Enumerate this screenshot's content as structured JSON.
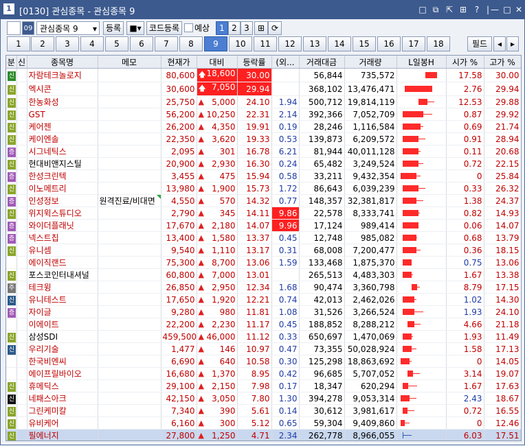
{
  "window": {
    "title": "[0130] 관심종목 - 관심종목 9",
    "app_icon": "1",
    "buttons": [
      "□",
      "⧉",
      "⇱",
      "⊞",
      "?",
      "|",
      "—",
      "□",
      "✕"
    ]
  },
  "toolbar": {
    "group_select": "관심종목 9",
    "register": "등록",
    "code_register": "코드등록",
    "reserve": "예상",
    "pages": [
      "1",
      "2",
      "3"
    ]
  },
  "tabs": [
    "1",
    "2",
    "3",
    "4",
    "5",
    "6",
    "7",
    "8",
    "9",
    "10",
    "11",
    "12",
    "13",
    "14",
    "15",
    "16",
    "17",
    "18"
  ],
  "selected_tab": "9",
  "field_button": "필드",
  "headers": [
    "분",
    "신",
    "종목명",
    "메모",
    "현재가",
    "대비",
    "등락률",
    "(외...",
    "거래대금",
    "거래량",
    "L일봉H",
    "시가 %",
    "고가 %"
  ],
  "rows": [
    {
      "badge": "신",
      "badge_color": "#2b8a2b",
      "name": "자람테크놀로지",
      "memo": "",
      "price": "80,600",
      "diff": "18,600",
      "rate": "30.00",
      "foreign": "",
      "amount": "56,844",
      "volume": "735,572",
      "open": "17.58",
      "high": "30.00",
      "up_arrow": true,
      "hi_diff": true,
      "hi_rate": true,
      "spark": {
        "x": 0.6,
        "w": 0.25,
        "wick": 0
      }
    },
    {
      "badge": "신",
      "badge_color": "#8aa52b",
      "name": "엑시콘",
      "memo": "",
      "price": "30,600",
      "diff": "7,050",
      "rate": "29.94",
      "foreign": "",
      "amount": "368,102",
      "volume": "13,476,471",
      "open": "2.76",
      "high": "29.94",
      "up_arrow": true,
      "hi_diff": true,
      "hi_rate": true,
      "spark": {
        "x": 0.15,
        "w": 0.6,
        "wick": 0
      }
    },
    {
      "badge": "신",
      "badge_color": "#8aa52b",
      "name": "한농화성",
      "memo": "",
      "price": "25,750",
      "diff": "5,000",
      "rate": "24.10",
      "foreign": "1.94",
      "amount": "500,712",
      "volume": "19,814,119",
      "open": "12.53",
      "high": "29.88",
      "spark": {
        "x": 0.45,
        "w": 0.2,
        "wick": 0.15
      }
    },
    {
      "badge": "신",
      "badge_color": "#8aa52b",
      "name": "GST",
      "memo": "",
      "price": "56,200",
      "diff": "10,250",
      "rate": "22.31",
      "foreign": "2.14",
      "amount": "392,366",
      "volume": "7,052,709",
      "open": "0.87",
      "high": "29.92",
      "spark": {
        "x": 0.1,
        "w": 0.45,
        "wick": 0.2
      }
    },
    {
      "badge": "신",
      "badge_color": "#8aa52b",
      "name": "케어젠",
      "memo": "",
      "price": "26,200",
      "diff": "4,350",
      "rate": "19.91",
      "foreign": "0.19",
      "amount": "28,246",
      "volume": "1,116,584",
      "open": "0.69",
      "high": "21.74",
      "spark": {
        "x": 0.1,
        "w": 0.4,
        "wick": 0.05
      }
    },
    {
      "badge": "신",
      "badge_color": "#8aa52b",
      "name": "케이엔솔",
      "memo": "",
      "price": "22,350",
      "diff": "3,620",
      "rate": "19.33",
      "foreign": "0.53",
      "amount": "139,873",
      "volume": "6,209,572",
      "open": "0.91",
      "high": "28.94",
      "spark": {
        "x": 0.1,
        "w": 0.35,
        "wick": 0.15
      }
    },
    {
      "badge": "증",
      "badge_color": "#a05ab5",
      "name": "시그네틱스",
      "memo": "",
      "price": "2,095",
      "diff": "301",
      "rate": "16.78",
      "foreign": "6.21",
      "amount": "81,944",
      "volume": "40,011,128",
      "open": "0.11",
      "high": "20.68",
      "spark": {
        "x": 0.1,
        "w": 0.35,
        "wick": 0.05
      }
    },
    {
      "badge": "신",
      "badge_color": "#8aa52b",
      "name": "현대비앤지스틸",
      "memo": "",
      "price": "20,900",
      "diff": "2,930",
      "rate": "16.30",
      "foreign": "0.24",
      "amount": "65,482",
      "volume": "3,249,524",
      "open": "0.72",
      "high": "22.15",
      "blk": true,
      "spark": {
        "x": 0.1,
        "w": 0.35,
        "wick": 0.1
      }
    },
    {
      "badge": "증",
      "badge_color": "#a05ab5",
      "name": "한성크린텍",
      "memo": "",
      "price": "3,455",
      "diff": "475",
      "rate": "15.94",
      "foreign": "0.58",
      "amount": "33,211",
      "volume": "9,432,354",
      "open": "0",
      "high": "25.84",
      "spark": {
        "x": 0.05,
        "w": 0.35,
        "wick": 0.1
      }
    },
    {
      "badge": "신",
      "badge_color": "#8aa52b",
      "name": "이노메트리",
      "memo": "",
      "price": "13,980",
      "diff": "1,900",
      "rate": "15.73",
      "foreign": "1.72",
      "amount": "86,643",
      "volume": "6,039,239",
      "open": "0.33",
      "high": "26.32",
      "spark": {
        "x": 0.1,
        "w": 0.35,
        "wick": 0.15
      }
    },
    {
      "badge": "증",
      "badge_color": "#a05ab5",
      "name": "인성정보",
      "memo": "원격진료/비대면",
      "price": "4,550",
      "diff": "570",
      "rate": "14.32",
      "foreign": "0.77",
      "amount": "148,357",
      "volume": "32,381,817",
      "open": "1.38",
      "high": "24.37",
      "spark": {
        "x": 0.1,
        "w": 0.3,
        "wick": 0.15
      }
    },
    {
      "badge": "신",
      "badge_color": "#8aa52b",
      "name": "위지윅스튜디오",
      "memo": "",
      "price": "2,790",
      "diff": "345",
      "rate": "14.11",
      "foreign": "9.86",
      "amount": "22,578",
      "volume": "8,333,741",
      "open": "0.82",
      "high": "14.93",
      "hi_foreign": true,
      "spark": {
        "x": 0.1,
        "w": 0.35,
        "wick": 0.02
      }
    },
    {
      "badge": "증",
      "badge_color": "#a05ab5",
      "name": "와이더플래닛",
      "memo": "",
      "price": "17,670",
      "diff": "2,180",
      "rate": "14.07",
      "foreign": "9.96",
      "amount": "17,124",
      "volume": "989,414",
      "open": "0.06",
      "high": "14.07",
      "hi_foreign": true,
      "spark": {
        "x": 0.1,
        "w": 0.35,
        "wick": 0
      }
    },
    {
      "badge": "증",
      "badge_color": "#a05ab5",
      "name": "넥스트칩",
      "memo": "",
      "price": "13,400",
      "diff": "1,580",
      "rate": "13.37",
      "foreign": "0.45",
      "amount": "12,748",
      "volume": "985,082",
      "open": "0.68",
      "high": "13.79",
      "spark": {
        "x": 0.1,
        "w": 0.3,
        "wick": 0.02
      }
    },
    {
      "badge": "신",
      "badge_color": "#8aa52b",
      "name": "유니셈",
      "memo": "",
      "price": "9,540",
      "diff": "1,110",
      "rate": "13.17",
      "foreign": "0.31",
      "amount": "68,008",
      "volume": "7,200,477",
      "open": "0.36",
      "high": "18.15",
      "spark": {
        "x": 0.1,
        "w": 0.3,
        "wick": 0.1
      }
    },
    {
      "badge": "",
      "badge_color": "",
      "name": "에이직랜드",
      "memo": "",
      "price": "75,300",
      "diff": "8,700",
      "rate": "13.06",
      "foreign": "1.59",
      "amount": "133,468",
      "volume": "1,875,370",
      "open": "0.75",
      "high": "13.06",
      "open_blue": true,
      "spark": {
        "x": 0.1,
        "w": 0.2,
        "wick": 0
      }
    },
    {
      "badge": "신",
      "badge_color": "#8aa52b",
      "name": "포스코인터내셔널",
      "memo": "",
      "price": "60,800",
      "diff": "7,000",
      "rate": "13.01",
      "foreign": "",
      "amount": "265,513",
      "volume": "4,483,303",
      "open": "1.67",
      "high": "13.38",
      "blk": true,
      "spark": {
        "x": 0.1,
        "w": 0.2,
        "wick": 0.02
      }
    },
    {
      "badge": "주",
      "badge_color": "#777777",
      "name": "테크윙",
      "memo": "",
      "price": "26,850",
      "diff": "2,950",
      "rate": "12.34",
      "foreign": "1.68",
      "amount": "90,474",
      "volume": "3,360,798",
      "open": "8.79",
      "high": "17.15",
      "spark": {
        "x": 0.3,
        "w": 0.12,
        "wick": 0.05
      }
    },
    {
      "badge": "신",
      "badge_color": "#2b5a8a",
      "name": "유니테스트",
      "memo": "",
      "price": "17,650",
      "diff": "1,920",
      "rate": "12.21",
      "foreign": "0.74",
      "amount": "42,013",
      "volume": "2,462,026",
      "open": "1.02",
      "high": "14.30",
      "open_blue": true,
      "spark": {
        "x": 0.1,
        "w": 0.25,
        "wick": 0.05
      }
    },
    {
      "badge": "증",
      "badge_color": "#a05ab5",
      "name": "자이글",
      "memo": "",
      "price": "9,280",
      "diff": "980",
      "rate": "11.81",
      "foreign": "1.08",
      "amount": "31,526",
      "volume": "3,266,524",
      "open": "1.93",
      "high": "24.10",
      "open_blue": true,
      "spark": {
        "x": 0.1,
        "w": 0.25,
        "wick": 0.2
      }
    },
    {
      "badge": "",
      "badge_color": "",
      "name": "이에이트",
      "memo": "",
      "price": "22,200",
      "diff": "2,230",
      "rate": "11.17",
      "foreign": "0.45",
      "amount": "188,852",
      "volume": "8,288,212",
      "open": "4.66",
      "high": "21.18",
      "spark": {
        "x": 0.2,
        "w": 0.15,
        "wick": 0.15
      }
    },
    {
      "badge": "신",
      "badge_color": "#8aa52b",
      "name": "삼성SDI",
      "memo": "",
      "price": "459,500",
      "diff": "46,000",
      "rate": "11.12",
      "foreign": "0.33",
      "amount": "650,697",
      "volume": "1,470,069",
      "open": "1.93",
      "high": "11.49",
      "blk": true,
      "spark": {
        "x": 0.1,
        "w": 0.2,
        "wick": 0.02
      }
    },
    {
      "badge": "신",
      "badge_color": "#2b5a8a",
      "name": "우리기술",
      "memo": "",
      "price": "1,477",
      "diff": "146",
      "rate": "10.97",
      "foreign": "0.47",
      "amount": "73,355",
      "volume": "50,028,924",
      "open": "1.58",
      "high": "17.13",
      "spark": {
        "x": 0.1,
        "w": 0.2,
        "wick": 0.1
      }
    },
    {
      "badge": "",
      "badge_color": "",
      "name": "한국비엔씨",
      "memo": "",
      "price": "6,690",
      "diff": "640",
      "rate": "10.58",
      "foreign": "0.30",
      "amount": "125,298",
      "volume": "18,863,692",
      "open": "0",
      "high": "14.05",
      "spark": {
        "x": 0.05,
        "w": 0.2,
        "wick": 0.05
      }
    },
    {
      "badge": "",
      "badge_color": "",
      "name": "에이프릴바이오",
      "memo": "",
      "price": "16,680",
      "diff": "1,370",
      "rate": "8.95",
      "foreign": "0.42",
      "amount": "96,685",
      "volume": "5,707,052",
      "open": "3.14",
      "high": "19.07",
      "spark": {
        "x": 0.2,
        "w": 0.12,
        "wick": 0.15
      }
    },
    {
      "badge": "신",
      "badge_color": "#8aa52b",
      "name": "휴메딕스",
      "memo": "",
      "price": "29,100",
      "diff": "2,150",
      "rate": "7.98",
      "foreign": "0.17",
      "amount": "18,347",
      "volume": "620,294",
      "open": "1.67",
      "high": "17.63",
      "spark": {
        "x": 0.1,
        "w": 0.12,
        "wick": 0.2
      }
    },
    {
      "badge": "신",
      "badge_color": "#111111",
      "name": "네패스아크",
      "memo": "",
      "price": "42,150",
      "diff": "3,050",
      "rate": "7.80",
      "foreign": "1.30",
      "amount": "394,278",
      "volume": "9,053,314",
      "open": "2.43",
      "high": "18.67",
      "open_blue": true,
      "spark": {
        "x": 0.05,
        "w": 0.2,
        "wick": 0.15
      }
    },
    {
      "badge": "신",
      "badge_color": "#8aa52b",
      "name": "그린케미칼",
      "memo": "",
      "price": "7,340",
      "diff": "390",
      "rate": "5.61",
      "foreign": "0.14",
      "amount": "30,612",
      "volume": "3,981,617",
      "open": "0.72",
      "high": "16.55",
      "spark": {
        "x": 0.1,
        "w": 0.1,
        "wick": 0.15
      }
    },
    {
      "badge": "신",
      "badge_color": "#8aa52b",
      "name": "유비케어",
      "memo": "",
      "price": "6,160",
      "diff": "300",
      "rate": "5.12",
      "foreign": "0.65",
      "amount": "59,304",
      "volume": "9,409,860",
      "open": "0",
      "high": "12.46",
      "spark": {
        "x": 0.05,
        "w": 0.1,
        "wick": 0.1
      }
    },
    {
      "badge": "신",
      "badge_color": "#8aa52b",
      "name": "필에너지",
      "memo": "",
      "price": "27,800",
      "diff": "1,250",
      "rate": "4.71",
      "foreign": "2.34",
      "amount": "262,778",
      "volume": "8,966,055",
      "open": "6.03",
      "high": "17.51",
      "last": true,
      "spark": {
        "x": 0.1,
        "w": 0.0,
        "wick": 0.2
      }
    }
  ]
}
